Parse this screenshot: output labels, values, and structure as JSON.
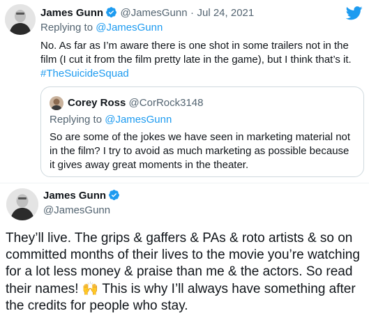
{
  "tweet": {
    "author_name": "James Gunn",
    "author_handle": "@JamesGunn",
    "date": "Jul 24, 2021",
    "separator": "·",
    "replying_prefix": "Replying to",
    "replying_handle": "@JamesGunn",
    "text_main": "No. As far as I’m aware there is one shot in some trailers not in the film (I cut it from the film pretty late in the game), but I think that’s it. ",
    "hashtag": "#TheSuicideSquad",
    "brand_icon": "twitter-bird-icon",
    "colors": {
      "link": "#1d9bf0",
      "muted": "#536471",
      "text": "#0f1419",
      "border": "#cfd9de"
    }
  },
  "quoted": {
    "author_name": "Corey Ross",
    "author_handle": "@CorRock3148",
    "replying_prefix": "Replying to",
    "replying_handle": "@JamesGunn",
    "text": "So are some of the jokes we have seen in marketing material not in the film?  I try to avoid as much marketing as possible because it gives away great moments in the theater."
  },
  "reply": {
    "author_name": "James Gunn",
    "author_handle": "@JamesGunn",
    "text_before_emoji": "They’ll live. The grips & gaffers & PAs & roto artists & so on committed months of their lives to the movie you’re watching for a lot less money & praise than me & the actors. So read their names! ",
    "emoji": "🙌",
    "text_after_emoji": " This is why I’ll always have something after the credits for people who stay."
  }
}
